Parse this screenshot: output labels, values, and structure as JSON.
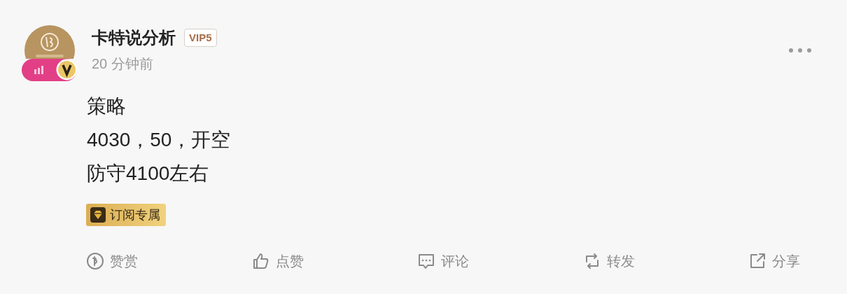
{
  "author": {
    "name": "卡特说分析",
    "vip_badge": "VIP5",
    "time": "20 分钟前"
  },
  "content": [
    "策略",
    "4030，50，开空",
    "防守4100左右"
  ],
  "tag": "订阅专属",
  "actions": [
    {
      "kind": "tip",
      "label": "赞赏"
    },
    {
      "kind": "like",
      "label": "点赞"
    },
    {
      "kind": "comment",
      "label": "评论"
    },
    {
      "kind": "repost",
      "label": "转发"
    },
    {
      "kind": "share",
      "label": "分享"
    }
  ]
}
